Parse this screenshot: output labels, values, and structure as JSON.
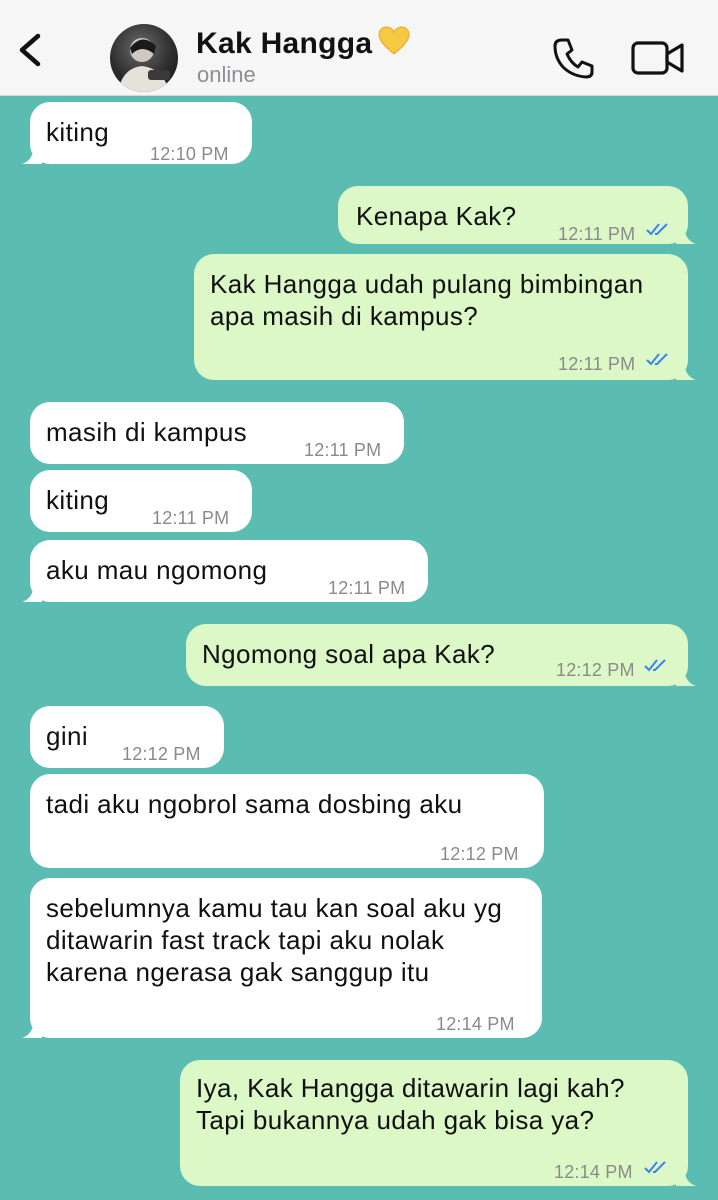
{
  "header": {
    "contact_name": "Kak Hangga",
    "status": "online",
    "icons": [
      "back-chevron-icon",
      "avatar",
      "yellow-heart-icon",
      "phone-icon",
      "video-camera-icon"
    ]
  },
  "colors": {
    "chat_background": "#5bbcb1",
    "incoming_bubble": "#ffffff",
    "outgoing_bubble": "#dcf8c6",
    "read_ticks": "#3b82f6"
  },
  "messages": [
    {
      "dir": "in",
      "text": "kiting",
      "time": "12:10 PM"
    },
    {
      "dir": "out",
      "text": "Kenapa Kak?",
      "time": "12:11 PM",
      "read": true
    },
    {
      "dir": "out",
      "text": "Kak Hangga udah pulang bimbingan apa masih di kampus?",
      "time": "12:11 PM",
      "read": true
    },
    {
      "dir": "in",
      "text": "masih di kampus",
      "time": "12:11 PM"
    },
    {
      "dir": "in",
      "text": "kiting",
      "time": "12:11 PM"
    },
    {
      "dir": "in",
      "text": "aku mau ngomong",
      "time": "12:11 PM"
    },
    {
      "dir": "out",
      "text": "Ngomong soal apa Kak?",
      "time": "12:12 PM",
      "read": true
    },
    {
      "dir": "in",
      "text": "gini",
      "time": "12:12 PM"
    },
    {
      "dir": "in",
      "text": "tadi aku ngobrol sama dosbing aku",
      "time": "12:12 PM"
    },
    {
      "dir": "in",
      "text": "sebelumnya kamu tau kan soal aku yg ditawarin fast track tapi aku nolak karena ngerasa gak sanggup itu",
      "time": "12:14 PM"
    },
    {
      "dir": "out",
      "text": "Iya, Kak Hangga ditawarin lagi kah? Tapi bukannya udah gak bisa ya?",
      "time": "12:14 PM",
      "read": true
    }
  ]
}
